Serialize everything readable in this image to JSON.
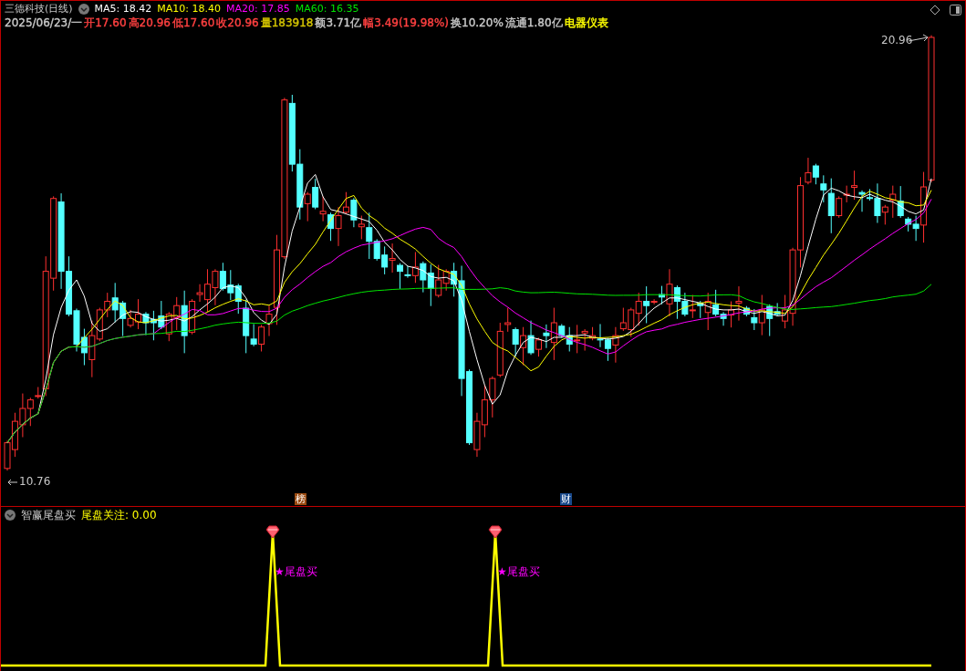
{
  "header": {
    "stock_title": "三德科技(日线)",
    "moving_averages": [
      {
        "label": "MA5: 18.42",
        "color": "#ffffff"
      },
      {
        "label": "MA10: 18.40",
        "color": "#ffff00"
      },
      {
        "label": "MA20: 17.85",
        "color": "#ff00ff"
      },
      {
        "label": "MA60: 16.35",
        "color": "#00e600"
      }
    ]
  },
  "quote": [
    {
      "text": "2025/06/23/一",
      "color": "#c8c8c8"
    },
    {
      "text": "开17.60",
      "color": "#ff4040"
    },
    {
      "text": "高20.96",
      "color": "#ff4040"
    },
    {
      "text": "低17.60",
      "color": "#ff4040"
    },
    {
      "text": "收20.96",
      "color": "#ff4040"
    },
    {
      "text": "量183918",
      "color": "#d4c400"
    },
    {
      "text": "额3.71亿",
      "color": "#c8c8c8"
    },
    {
      "text": "幅3.49(19.98%)",
      "color": "#ff4040"
    },
    {
      "text": "换10.20%",
      "color": "#c8c8c8"
    },
    {
      "text": "流通1.80亿",
      "color": "#c8c8c8"
    },
    {
      "text": "电器仪表",
      "color": "#ffff00"
    }
  ],
  "price_max": "20.96",
  "price_min": "10.76",
  "event_marks": [
    {
      "text": "榜",
      "color": "#9a4a10"
    },
    {
      "text": "财",
      "color": "#1a4a8c"
    }
  ],
  "indicator": {
    "title": "智赢尾盘买",
    "readout": "尾盘关注: 0.00",
    "signals": [
      {
        "text": "★尾盘买"
      },
      {
        "text": "★尾盘买"
      }
    ]
  }
}
